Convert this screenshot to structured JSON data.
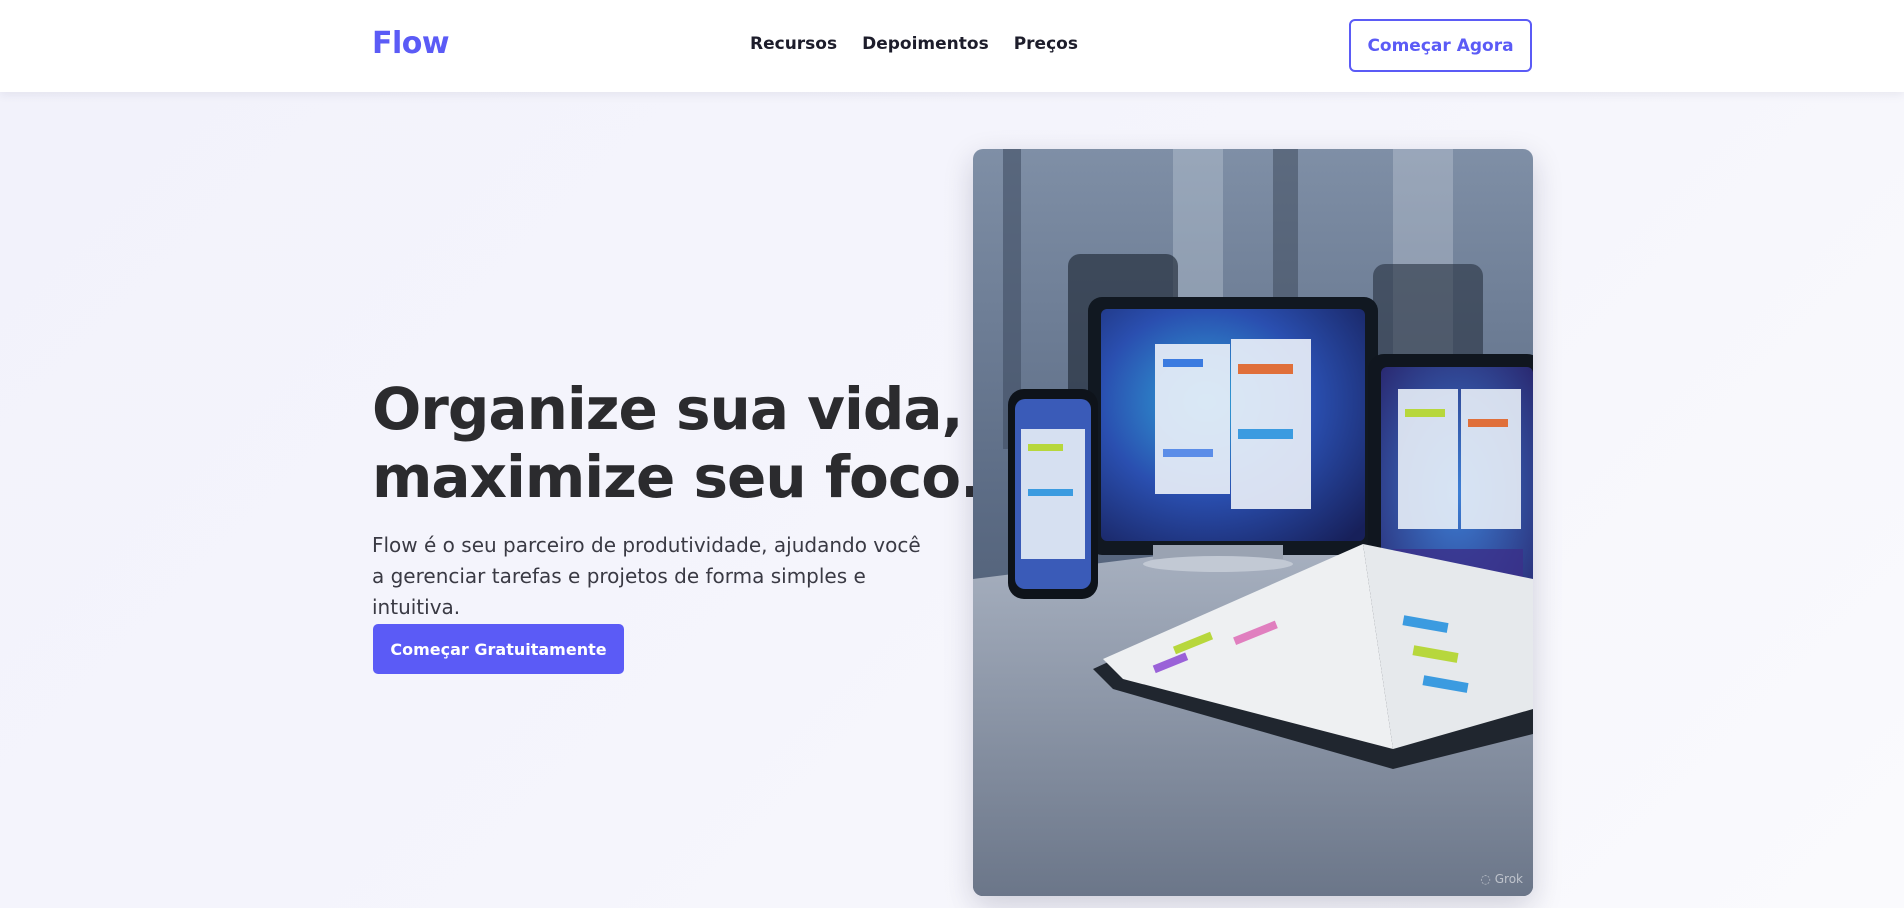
{
  "header": {
    "logo": "Flow",
    "nav": [
      {
        "label": "Recursos"
      },
      {
        "label": "Depoimentos"
      },
      {
        "label": "Preços"
      }
    ],
    "cta_label": "Começar Agora"
  },
  "hero": {
    "title_line1": "Organize sua vida,",
    "title_line2": "maximize seu foco.",
    "subtitle": "Flow é o seu parceiro de produtividade, ajudando você a gerenciar tarefas e projetos de forma simples e intuitiva.",
    "cta_label": "Começar Gratuitamente",
    "image": {
      "watermark": "Grok"
    }
  },
  "colors": {
    "accent": "#5b5bf6",
    "text_dark": "#2b2b2e",
    "background": "#f4f4fb"
  }
}
